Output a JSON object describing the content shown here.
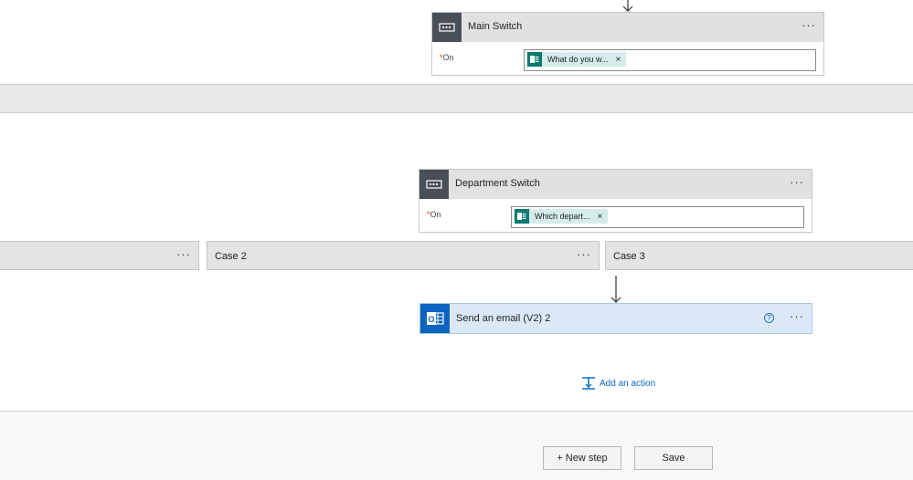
{
  "main_switch": {
    "title": "Main Switch",
    "more_label": "···",
    "on_required": "*",
    "on_label": "On",
    "token_text": "What do you w...",
    "token_remove": "×",
    "icon": "switch-icon"
  },
  "department_switch": {
    "title": "Department Switch",
    "more_label": "···",
    "on_required": "*",
    "on_label": "On",
    "token_text": "Which depart...",
    "token_remove": "×",
    "icon": "switch-icon"
  },
  "cases": [
    {
      "label": "",
      "more_label": "···"
    },
    {
      "label": "Case 2",
      "more_label": "···"
    },
    {
      "label": "Case 3",
      "more_label": ""
    }
  ],
  "email_action": {
    "title": "Send an email (V2) 2",
    "help": "?",
    "more_label": "···",
    "icon": "outlook-icon"
  },
  "add_action": {
    "label": "Add an action",
    "icon": "add-action-icon"
  },
  "footer": {
    "new_step": "+ New step",
    "save": "Save"
  },
  "colors": {
    "accent": "#0b6bcb",
    "forms_green": "#037c6e",
    "outlook_blue": "#0b64c0",
    "header_dark": "#484f58"
  }
}
